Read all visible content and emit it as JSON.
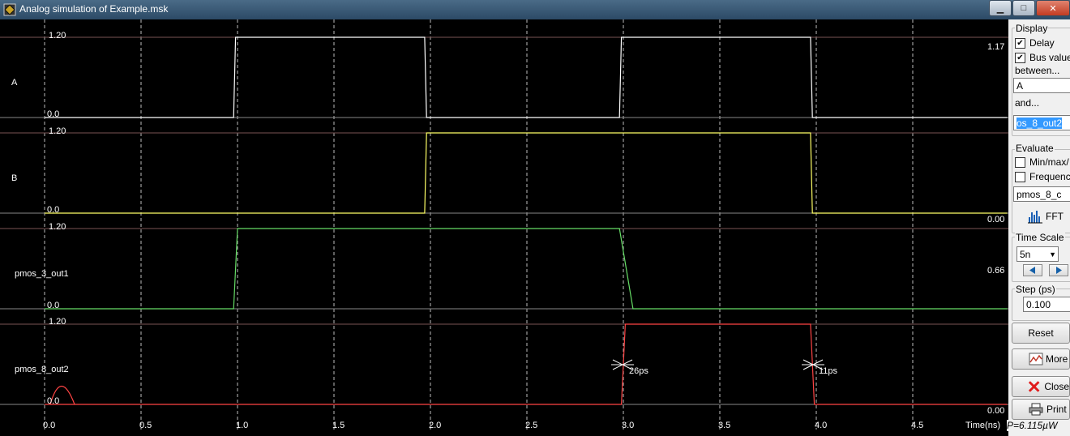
{
  "window": {
    "title": "Analog simulation of Example.msk"
  },
  "time_axis": {
    "label": "Time(ns)",
    "ticks": [
      "0.0",
      "0.5",
      "1.0",
      "1.5",
      "2.0",
      "2.5",
      "3.0",
      "3.5",
      "4.0",
      "4.5"
    ]
  },
  "signals": [
    {
      "name": "A",
      "max_label": "1.20",
      "min_label": "0.0",
      "right_value": "1.17",
      "color": "#ffffff"
    },
    {
      "name": "B",
      "max_label": "1.20",
      "min_label": "0.0",
      "right_value": "",
      "color": "#ffff66"
    },
    {
      "name": "pmos_3_out1",
      "max_label": "1.20",
      "min_label": "0.0",
      "right_value": "0.00",
      "color": "#66dd66"
    },
    {
      "name": "pmos_8_out2",
      "max_label": "1.20",
      "min_label": "0.0",
      "right_value": "0.66",
      "color": "#ff4444"
    }
  ],
  "bottom_right_value": "0.00",
  "delay_markers": [
    {
      "label": "26ps"
    },
    {
      "label": "11ps"
    }
  ],
  "panel": {
    "display_title": "Display",
    "delay_label": "Delay",
    "delay_checked": true,
    "bus_label": "Bus value",
    "bus_checked": true,
    "between_label": "between...",
    "between_value": "A",
    "and_label": "and...",
    "and_value": "os_8_out2",
    "evaluate_title": "Evaluate",
    "minmax_label": "Min/max/",
    "frequency_label": "Frequenc",
    "evaluate_select": "pmos_8_c",
    "fft_label": "FFT",
    "timescale_title": "Time Scale",
    "timescale_value": "5n",
    "step_title": "Step (ps)",
    "step_value": "0.100",
    "reset_label": "Reset",
    "more_label": "More",
    "close_label": "Close",
    "print_label": "Print"
  },
  "power": "P=6.115µW"
}
